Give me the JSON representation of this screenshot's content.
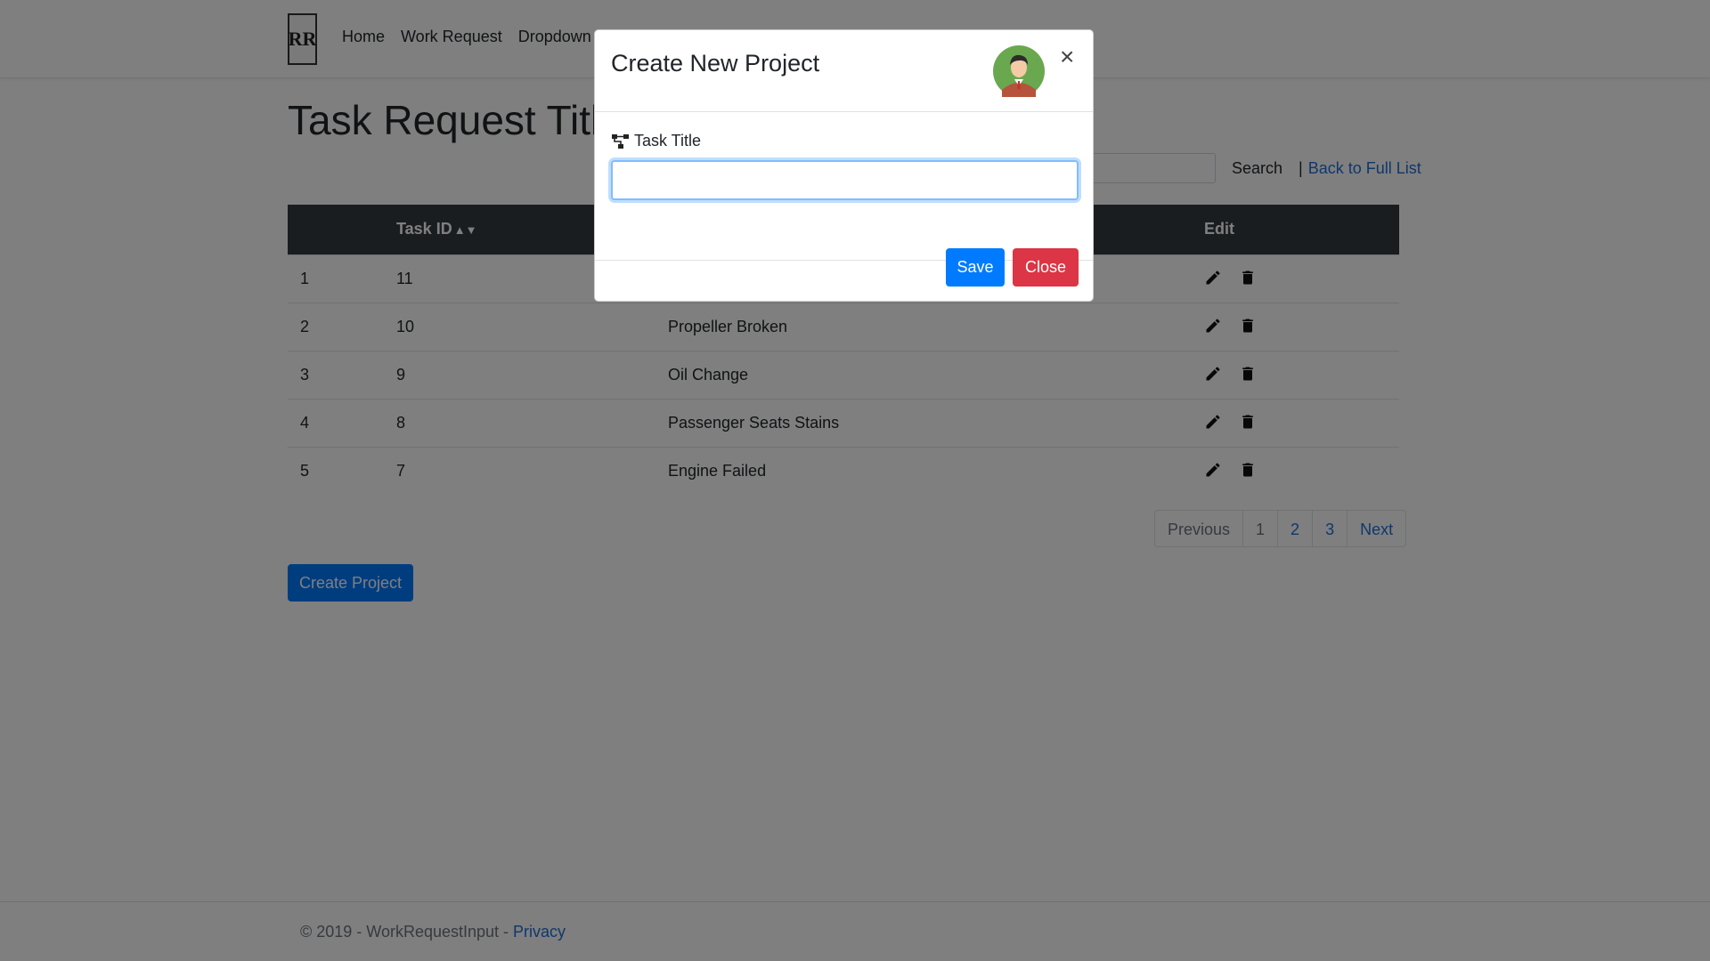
{
  "navbar": {
    "logo_text": "RR",
    "links": [
      "Home",
      "Work Request",
      "Dropdown"
    ]
  },
  "page": {
    "title": "Task Request Title",
    "search": {
      "placeholder": "",
      "button_label": "Search",
      "separator": "|",
      "back_link": "Back to Full List"
    },
    "table": {
      "headers": [
        "",
        "Task ID",
        "",
        "Edit"
      ],
      "rows": [
        {
          "num": "1",
          "id": "11",
          "title": ""
        },
        {
          "num": "2",
          "id": "10",
          "title": "Propeller Broken"
        },
        {
          "num": "3",
          "id": "9",
          "title": "Oil Change"
        },
        {
          "num": "4",
          "id": "8",
          "title": "Passenger Seats Stains"
        },
        {
          "num": "5",
          "id": "7",
          "title": "Engine Failed"
        }
      ]
    },
    "pagination": [
      "Previous",
      "1",
      "2",
      "3",
      "Next"
    ],
    "create_button": "Create Project"
  },
  "footer": {
    "copyright": "© 2019 - WorkRequestInput - ",
    "privacy_link": "Privacy"
  },
  "modal": {
    "title": "Create New Project",
    "close_symbol": "×",
    "field_label": "Task Title",
    "field_value": "",
    "save_label": "Save",
    "close_label": "Close"
  },
  "colors": {
    "primary": "#007bff",
    "danger": "#dc3545",
    "table_header": "#343a40",
    "link": "#1f6fd6"
  }
}
